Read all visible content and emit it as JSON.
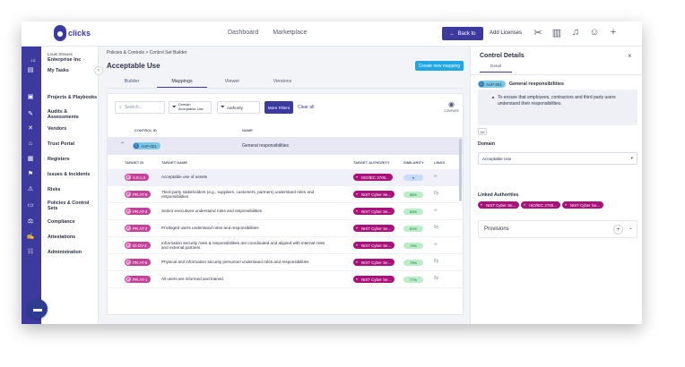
{
  "brand": {
    "name": "clicks"
  },
  "topnav": {
    "dashboard": "Dashboard",
    "marketplace": "Marketplace",
    "back": "Back to",
    "add_licenses": "Add Licenses"
  },
  "user": {
    "initials": "LS",
    "name": "Louis Strauss",
    "org": "Enterprise Inc"
  },
  "sidebar": {
    "items": [
      {
        "label": "My Tasks",
        "icon": "clipboard-icon"
      },
      {
        "label": "Projects & Playbooks",
        "icon": "briefcase-icon"
      },
      {
        "label": "Audits & Assessments",
        "icon": "edit-icon"
      },
      {
        "label": "Vendors",
        "icon": "handshake-icon"
      },
      {
        "label": "Trust Portal",
        "icon": "portal-icon"
      },
      {
        "label": "Registers",
        "icon": "calendar-icon"
      },
      {
        "label": "Issues & Incidents",
        "icon": "flag-icon"
      },
      {
        "label": "Risks",
        "icon": "warning-icon"
      },
      {
        "label": "Policies & Control Sets",
        "icon": "document-icon"
      },
      {
        "label": "Compliance",
        "icon": "scale-icon"
      },
      {
        "label": "Attestations",
        "icon": "signature-icon"
      },
      {
        "label": "Administration",
        "icon": "people-icon"
      }
    ]
  },
  "main": {
    "breadcrumb": "Policies & Controls  >  Control Set Builder",
    "title": "Acceptable Use",
    "create_button": "Create new mapping",
    "tabs": [
      "Builder",
      "Mappings",
      "Viewer",
      "Versions"
    ],
    "active_tab": 1,
    "search_placeholder": "Search...",
    "filter_domain_label": "Domain",
    "filter_domain_value": "Acceptable Use",
    "filter_authority": "Authority",
    "more_filters": "More Filters",
    "clear_all": "Clear all",
    "compare_label": "COMPARE",
    "parent_headers": {
      "control_id": "CONTROL ID",
      "name": "NAME"
    },
    "parent": {
      "id": "AUP-001",
      "name": "General responsibilities"
    },
    "child_headers": {
      "target_id": "TARGET ID",
      "target_name": "TARGET NAME",
      "target_authority": "TARGET AUTHORITY",
      "similarity": "SIMILARITY",
      "links": "LINKS"
    },
    "rows": [
      {
        "id": "A.8.1.3",
        "name": "Acceptable use of assets",
        "authority": "ISO/IEC 2700...",
        "similarity": "",
        "links": "∞",
        "highlight": true
      },
      {
        "id": "PR.AT-5",
        "name": "Third-party stakeholders (e.g., suppliers, customers, partners) understand roles and responsibilities",
        "authority": "NIST Cyber Se...",
        "similarity": "85%",
        "links": "8γ"
      },
      {
        "id": "PR.AT-4",
        "name": "Senior executives understand roles and responsibilities",
        "authority": "NIST Cyber Se...",
        "similarity": "83%",
        "links": "∞"
      },
      {
        "id": "PR.AT-2",
        "name": "Privileged users understand roles and responsibilities",
        "authority": "NIST Cyber Se...",
        "similarity": "81%",
        "links": "8γ"
      },
      {
        "id": "ID.GV-2",
        "name": "Information security roles & responsibilities are coordinated and aligned with internal roles and external partners",
        "authority": "NIST Cyber Se...",
        "similarity": "79%",
        "links": "∞"
      },
      {
        "id": "PR.AT-5",
        "name": "Physical and information security personnel understand roles and responsibilities",
        "authority": "NIST Cyber Se...",
        "similarity": "79%",
        "links": "8γ"
      },
      {
        "id": "PR.AT-1",
        "name": "All users are informed and trained",
        "authority": "NIST Cyber Se...",
        "similarity": "77%",
        "links": "8γ"
      }
    ]
  },
  "panel": {
    "title": "Control Details",
    "tab": "Detail",
    "control_id": "AUP-001",
    "control_name": "General responsibilities",
    "description": "To ensure that employees, contractors and third party users understand their responsibilities.",
    "aa": "Aa",
    "domain_label": "Domain",
    "domain_value": "Acceptable Use",
    "linked_label": "Linked Authorities",
    "linked": [
      "NIST Cyber Se...",
      "ISO/IEC 2700...",
      "NIST Cyber Se..."
    ],
    "provisions": "Provisions"
  }
}
